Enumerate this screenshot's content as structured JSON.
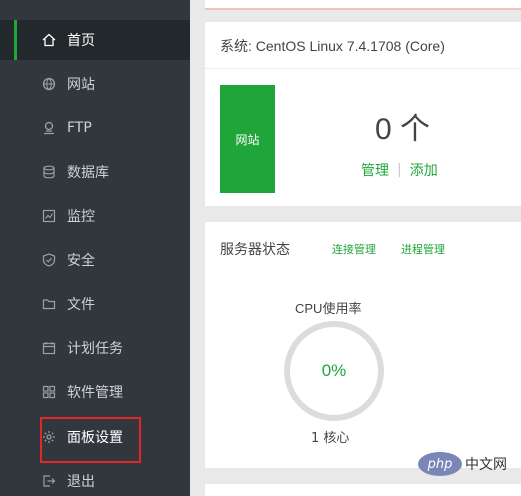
{
  "sidebar": {
    "items": [
      {
        "label": "首页",
        "icon": "home-icon",
        "active": true
      },
      {
        "label": "网站",
        "icon": "globe-icon"
      },
      {
        "label": "FTP",
        "icon": "ftp-icon"
      },
      {
        "label": "数据库",
        "icon": "database-icon"
      },
      {
        "label": "监控",
        "icon": "monitor-icon"
      },
      {
        "label": "安全",
        "icon": "shield-icon"
      },
      {
        "label": "文件",
        "icon": "folder-icon"
      },
      {
        "label": "计划任务",
        "icon": "calendar-icon"
      },
      {
        "label": "软件管理",
        "icon": "grid-icon"
      },
      {
        "label": "面板设置",
        "icon": "gear-icon",
        "highlighted": true
      },
      {
        "label": "退出",
        "icon": "logout-icon"
      }
    ]
  },
  "system": {
    "title": "系统: CentOS Linux 7.4.1708 (Core)",
    "site_tile_label": "网站",
    "site_count": "0 个",
    "manage_label": "管理",
    "separator": "|",
    "add_label": "添加"
  },
  "server_status": {
    "title": "服务器状态",
    "connection_link": "连接管理",
    "process_link": "进程管理",
    "cpu_label": "CPU使用率",
    "cpu_value": "0%",
    "cpu_cores": "1 核心"
  },
  "watermark": {
    "logo": "php",
    "text": "中文网"
  },
  "colors": {
    "sidebar_bg": "#31373c",
    "active_bg": "#23282c",
    "accent": "#20a53a",
    "highlight_border": "#e2262a"
  }
}
